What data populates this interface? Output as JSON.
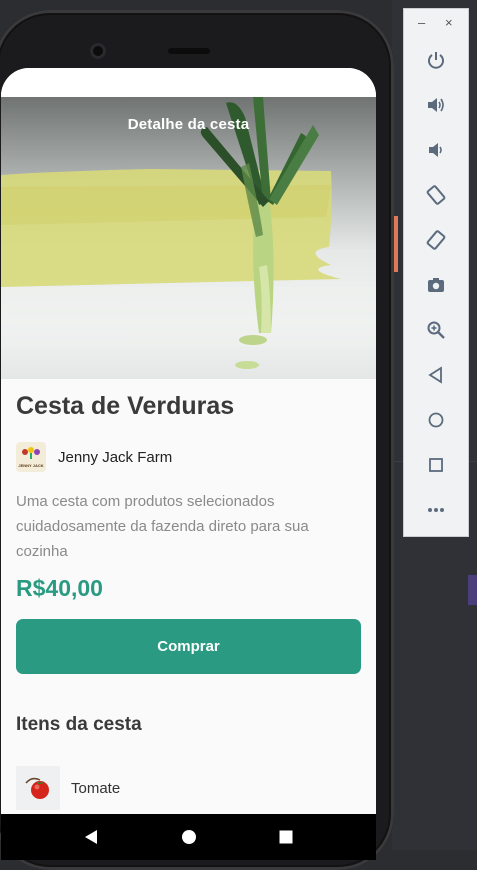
{
  "app": {
    "screen_title": "Detalhe da cesta",
    "basket": {
      "name": "Cesta de Verduras",
      "farm_name": "Jenny Jack Farm",
      "farm_logo_text": "JENNY JACK",
      "description": "Uma cesta com produtos selecionados cuidadosamente da fazenda direto para sua cozinha",
      "price": "R$40,00",
      "buy_label": "Comprar"
    },
    "items_title": "Itens da cesta",
    "items": [
      {
        "name": "Tomate",
        "icon": "tomato-icon"
      }
    ]
  },
  "emulator_toolbar": {
    "minimize": "–",
    "close": "×",
    "buttons": [
      "power-icon",
      "volume-up-icon",
      "volume-down-icon",
      "rotate-left-icon",
      "rotate-right-icon",
      "camera-icon",
      "zoom-icon",
      "back-icon",
      "home-icon",
      "overview-icon",
      "more-icon"
    ]
  },
  "colors": {
    "accent": "#2a9a82",
    "title_text": "#3a3a3a",
    "description_text": "#8a8a8a",
    "toolbar_icon": "#5b6b7d"
  }
}
